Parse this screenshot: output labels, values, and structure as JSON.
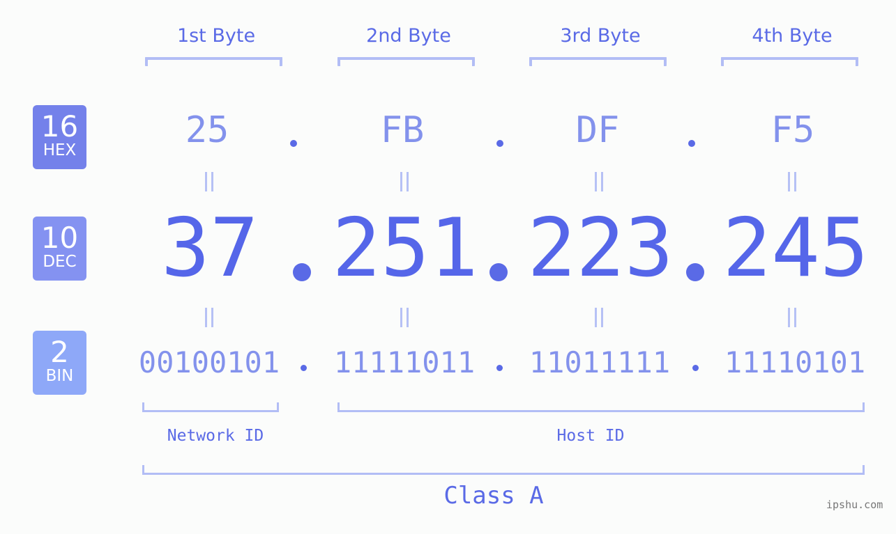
{
  "byte_headers": [
    "1st Byte",
    "2nd Byte",
    "3rd Byte",
    "4th Byte"
  ],
  "badges": {
    "hex": {
      "base": "16",
      "label": "HEX",
      "color": "#7481ea"
    },
    "dec": {
      "base": "10",
      "label": "DEC",
      "color": "#8492f1"
    },
    "bin": {
      "base": "2",
      "label": "BIN",
      "color": "#8ea8f8"
    }
  },
  "ip": {
    "hex": [
      "25",
      "FB",
      "DF",
      "F5"
    ],
    "dec": [
      "37",
      "251",
      "223",
      "245"
    ],
    "bin": [
      "00100101",
      "11111011",
      "11011111",
      "11110101"
    ]
  },
  "segments": {
    "network_id": "Network ID",
    "host_id": "Host ID",
    "class": "Class A"
  },
  "colors": {
    "accent": "#5566e9",
    "light_accent": "#8392ec",
    "bracket": "#b2bdf5"
  },
  "watermark": "ipshu.com"
}
